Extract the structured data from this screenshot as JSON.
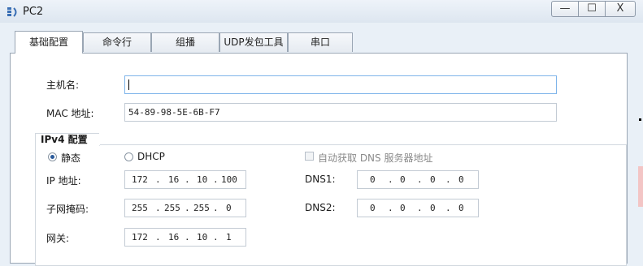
{
  "window": {
    "title": "PC2",
    "controls": {
      "minimize": "—",
      "maximize": "☐",
      "close": "X"
    }
  },
  "tabs": [
    {
      "label": "基础配置",
      "active": true
    },
    {
      "label": "命令行",
      "active": false
    },
    {
      "label": "组播",
      "active": false
    },
    {
      "label": "UDP发包工具",
      "active": false
    },
    {
      "label": "串口",
      "active": false
    }
  ],
  "basic": {
    "hostname_label": "主机名:",
    "hostname_value": "",
    "mac_label": "MAC 地址:",
    "mac_value": "54-89-98-5E-6B-F7"
  },
  "ipv4": {
    "group_title": "IPv4 配置",
    "static_label": "静态",
    "dhcp_label": "DHCP",
    "mode": "static",
    "auto_dns_label": "自动获取 DNS 服务器地址",
    "auto_dns_checked": false,
    "ip_label": "IP 地址:",
    "ip": [
      "172",
      "16",
      "10",
      "100"
    ],
    "mask_label": "子网掩码:",
    "mask": [
      "255",
      "255",
      "255",
      "0"
    ],
    "gateway_label": "网关:",
    "gateway": [
      "172",
      "16",
      "10",
      "1"
    ],
    "dns1_label": "DNS1:",
    "dns1": [
      "0",
      "0",
      "0",
      "0"
    ],
    "dns2_label": "DNS2:",
    "dns2": [
      "0",
      "0",
      "0",
      "0"
    ],
    "dot": "."
  }
}
